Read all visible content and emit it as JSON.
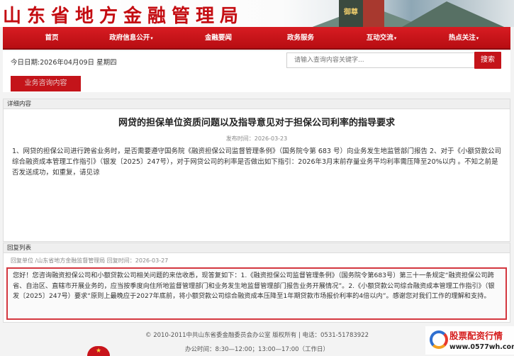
{
  "site": {
    "title": "山东省地方金融管理局",
    "stele_text": "御尊"
  },
  "nav": {
    "items": [
      {
        "label": "首页",
        "has_dropdown": false
      },
      {
        "label": "政府信息公开",
        "has_dropdown": true
      },
      {
        "label": "金融要闻",
        "has_dropdown": false
      },
      {
        "label": "政务服务",
        "has_dropdown": false
      },
      {
        "label": "互动交流",
        "has_dropdown": true
      },
      {
        "label": "热点关注",
        "has_dropdown": true
      }
    ],
    "caret": "▾"
  },
  "toprow": {
    "today": "今日日期:2026年04月09日 星期四",
    "search_placeholder": "请输入查询内容关键字...",
    "search_button": "搜索"
  },
  "consult": {
    "tab_label": "业务咨询内容"
  },
  "detail": {
    "header": "详细内容",
    "title": "网贷的担保单位资质问题以及指导意见对于担保公司利率的指导要求",
    "meta": "发布时间：2026-03-23",
    "body": "1、网贷的担保公司进行跨省业务时，是否需要遵守国务院《融资担保公司监督管理条例》（国务院令第 683 号）向业务发生地监管部门报告 2、对于《小额贷款公司综合融资成本管理工作指引》（银发〔2025〕247号），对于网贷公司的利率是否做出如下指引：2026年3月末前存量业务平均利率需压降至20%以内 。不知之前是否发送成功，如重复，请见谅"
  },
  "replies": {
    "header": "回复列表",
    "meta": "回复单位 /山东省地方金融监督管理局          回复时间：2026-03-27",
    "body": "您好！您咨询融资担保公司和小额贷款公司相关问题的来信收悉，现答复如下：1.《融资担保公司监督管理条例》（国务院令第683号）第三十一条规定“融资担保公司跨省、自治区、直辖市开展业务的，应当按季度向住所地监督管理部门和业务发生地监督管理部门报告业务开展情况”。2.《小额贷款公司综合融资成本管理工作指引》（银发〔2025〕247号）要求“原则上最晚应于2027年底前，将小额贷款公司综合融资成本压降至1年期贷款市场报价利率的4倍以内”。感谢您对我们工作的理解和支持。"
  },
  "footer": {
    "copyright": "© 2010-2011中共山东省委金融委员会办公室 版权所有 | 电话：0531-51783922",
    "hours": "办公时间：8:30—12:00；13:00—17:00（工作日）"
  },
  "watermark": {
    "text": "股票配资行情",
    "url": "www.0577wh.com"
  }
}
